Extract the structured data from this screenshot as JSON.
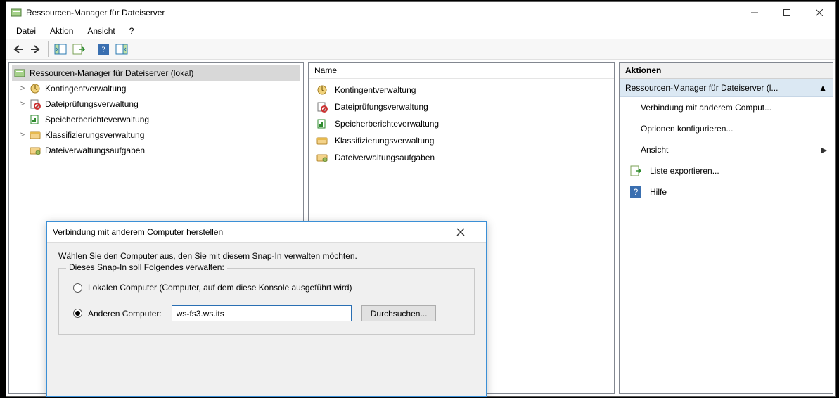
{
  "window": {
    "title": "Ressourcen-Manager für Dateiserver"
  },
  "menubar": {
    "items": [
      "Datei",
      "Aktion",
      "Ansicht",
      "?"
    ]
  },
  "tree": {
    "root": "Ressourcen-Manager für Dateiserver (lokal)",
    "items": [
      "Kontingentverwaltung",
      "Dateiprüfungsverwaltung",
      "Speicherberichteverwaltung",
      "Klassifizierungsverwaltung",
      "Dateiverwaltungsaufgaben"
    ]
  },
  "list": {
    "header": "Name",
    "items": [
      "Kontingentverwaltung",
      "Dateiprüfungsverwaltung",
      "Speicherberichteverwaltung",
      "Klassifizierungsverwaltung",
      "Dateiverwaltungsaufgaben"
    ]
  },
  "actions": {
    "header": "Aktionen",
    "section": "Ressourcen-Manager für Dateiserver (l...",
    "items": [
      "Verbindung mit anderem Comput...",
      "Optionen konfigurieren...",
      "Ansicht",
      "Liste exportieren...",
      "Hilfe"
    ]
  },
  "dialog": {
    "title": "Verbindung mit anderem Computer herstellen",
    "prompt": "Wählen Sie den Computer aus, den Sie mit diesem Snap-In verwalten möchten.",
    "group_legend": "Dieses Snap-In soll Folgendes verwalten:",
    "radio_local": "Lokalen Computer (Computer, auf dem diese Konsole ausgeführt wird)",
    "radio_other": "Anderen Computer:",
    "computer_value": "ws-fs3.ws.its",
    "browse": "Durchsuchen..."
  }
}
